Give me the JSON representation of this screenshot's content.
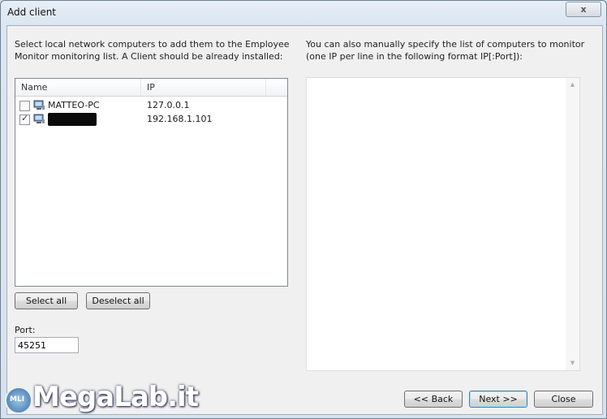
{
  "window": {
    "title": "Add client",
    "close_glyph": "x"
  },
  "left_panel": {
    "description": "Select local network computers to add them to the Employee Monitor monitoring list. A Client should be already installed:",
    "columns": [
      "Name",
      "IP"
    ],
    "rows": [
      {
        "name": "MATTEO-PC",
        "ip": "127.0.0.1",
        "checked": false,
        "icon": "computer-icon"
      },
      {
        "name": "",
        "ip": "192.168.1.101",
        "checked": true,
        "icon": "computer-icon",
        "name_redacted": true
      }
    ],
    "select_all_label": "Select all",
    "deselect_all_label": "Deselect all",
    "port_label": "Port:",
    "port_value": "45251"
  },
  "right_panel": {
    "description": "You can also manually specify the list of computers to monitor (one IP per line in the following format IP[:Port]):",
    "computers_text": ""
  },
  "footer": {
    "back_label": "<< Back",
    "next_label": "Next >>",
    "close_label": "Close"
  },
  "watermark": {
    "text": "MegaLab.it",
    "logo_text": "MLI"
  }
}
